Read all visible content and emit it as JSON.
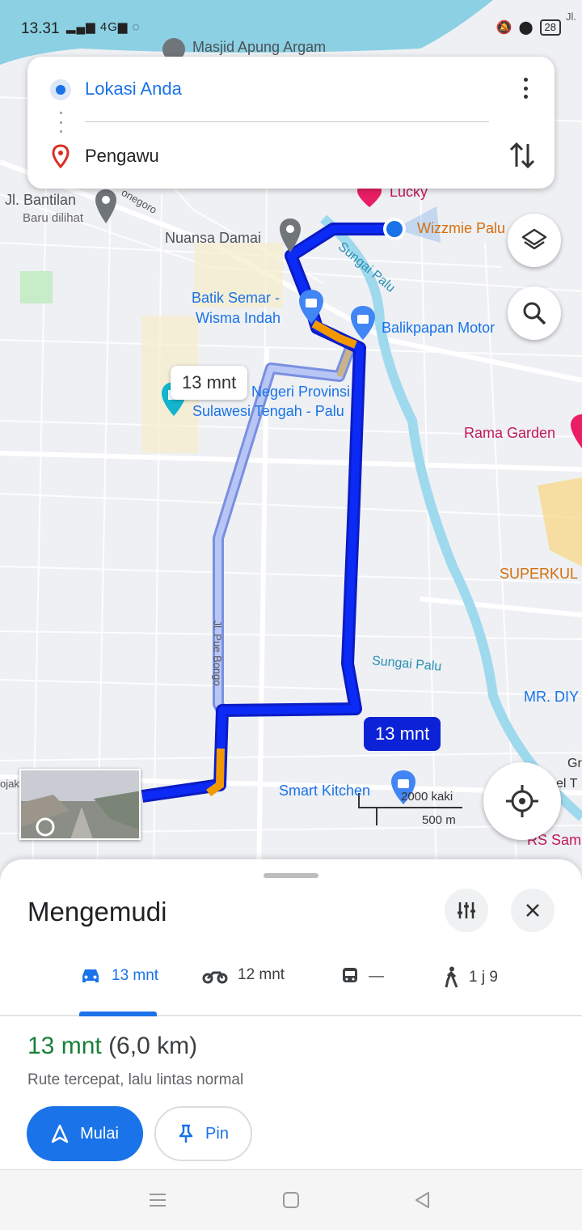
{
  "status_bar": {
    "time": "13.31",
    "signal": "4G",
    "battery": "28"
  },
  "route_card": {
    "origin": "Lokasi Anda",
    "destination": "Pengawu"
  },
  "map": {
    "labels": {
      "masjid": "Masjid Apung Argam",
      "lucky": "Lucky",
      "bantilan": "Jl. Bantilan",
      "baru_dilihat": "Baru dilihat",
      "negoro": "onegoro",
      "nuansa_damai": "Nuansa Damai",
      "wizzmie": "Wizzmie Palu",
      "sungai_palu_top": "Sungai Palu",
      "batik_semar": "Batik Semar -",
      "wisma_indah": "Wisma Indah",
      "balikpapan": "Balikpapan Motor",
      "negeri_provinsi": "n Negeri Provinsi",
      "sulawesi_tengah": "Sulawesi Tengah - Palu",
      "rama_garden": "Rama Garden",
      "superkul": "SUPERKUL",
      "pue_bongo": "Jl. Pue Bongo",
      "sungai_palu_mid": "Sungai Palu",
      "mr_diy": "MR. DIY",
      "smart_kitchen": "Smart Kitchen",
      "rs_sam": "RS Sam",
      "gr": "Gr",
      "sel_t": "sel T",
      "ojak": "ojak",
      "jl_corner": "Jl."
    },
    "alt_route_time": "13 mnt",
    "main_route_time": "13 mnt",
    "scale_imperial": "2000 kaki",
    "scale_metric": "500 m"
  },
  "sheet": {
    "title": "Mengemudi",
    "modes": [
      {
        "icon": "car-icon",
        "label": "13 mnt",
        "active": true
      },
      {
        "icon": "motorcycle-icon",
        "label": "12 mnt",
        "active": false
      },
      {
        "icon": "transit-icon",
        "label": "—",
        "active": false
      },
      {
        "icon": "walk-icon",
        "label": "1 j 9",
        "active": false
      }
    ],
    "eta_time": "13 mnt",
    "eta_distance": "(6,0 km)",
    "route_description": "Rute tercepat, lalu lintas normal",
    "start_label": "Mulai",
    "pin_label": "Pin"
  },
  "colors": {
    "primary_blue": "#1a73e8",
    "route_blue": "#0c22f0",
    "traffic_orange": "#f29900",
    "eta_green": "#188038"
  }
}
